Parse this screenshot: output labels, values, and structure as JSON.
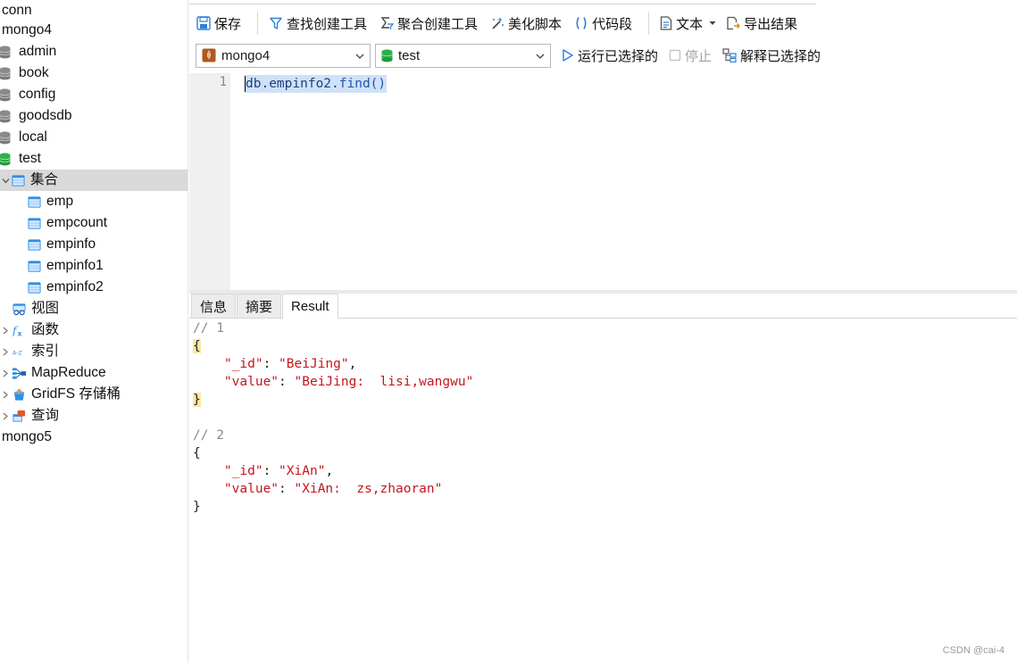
{
  "sidebar": {
    "connections": [
      {
        "label": "conn"
      },
      {
        "label": "mongo4"
      },
      {
        "label": "mongo5"
      }
    ],
    "databases": [
      {
        "label": "admin"
      },
      {
        "label": "book"
      },
      {
        "label": "config"
      },
      {
        "label": "goodsdb"
      },
      {
        "label": "local"
      },
      {
        "label": "test"
      }
    ],
    "test_children": {
      "collections": {
        "label": "集合",
        "items": [
          {
            "label": "emp"
          },
          {
            "label": "empcount"
          },
          {
            "label": "empinfo"
          },
          {
            "label": "empinfo1"
          },
          {
            "label": "empinfo2"
          }
        ]
      },
      "views": {
        "label": "视图"
      },
      "functions": {
        "label": "函数"
      },
      "indexes": {
        "label": "索引"
      },
      "mapreduce": {
        "label": "MapReduce"
      },
      "gridfs": {
        "label": "GridFS 存储桶"
      },
      "queries": {
        "label": "查询"
      }
    }
  },
  "toolbar": {
    "save": "保存",
    "find_builder": "查找创建工具",
    "aggregate_builder": "聚合创建工具",
    "beautify": "美化脚本",
    "snippet": "代码段",
    "text": "文本",
    "export": "导出结果"
  },
  "query_bar": {
    "connection": "mongo4",
    "database": "test",
    "run_selected": "运行已选择的",
    "stop": "停止",
    "explain_selected": "解释已选择的"
  },
  "editor": {
    "line_number": "1",
    "code_prefix": "db.empinfo2.",
    "code_fn": "find()"
  },
  "result_tabs": [
    {
      "label": "信息"
    },
    {
      "label": "摘要"
    },
    {
      "label": "Result"
    }
  ],
  "results": [
    {
      "comment": "// 1",
      "id_key": "\"_id\"",
      "id_value": "\"BeiJing\"",
      "value_key": "\"value\"",
      "value_value": "\"BeiJing:  lisi,wangwu\""
    },
    {
      "comment": "// 2",
      "id_key": "\"_id\"",
      "id_value": "\"XiAn\"",
      "value_key": "\"value\"",
      "value_value": "\"XiAn:  zs,zhaoran\""
    }
  ],
  "watermark": "CSDN @cai-4",
  "colors": {
    "selected_row": "#d9d9d9",
    "json_string": "#c4161c",
    "selection_highlight": "#cfe1f7",
    "brace_highlight": "#fbe7a0"
  }
}
